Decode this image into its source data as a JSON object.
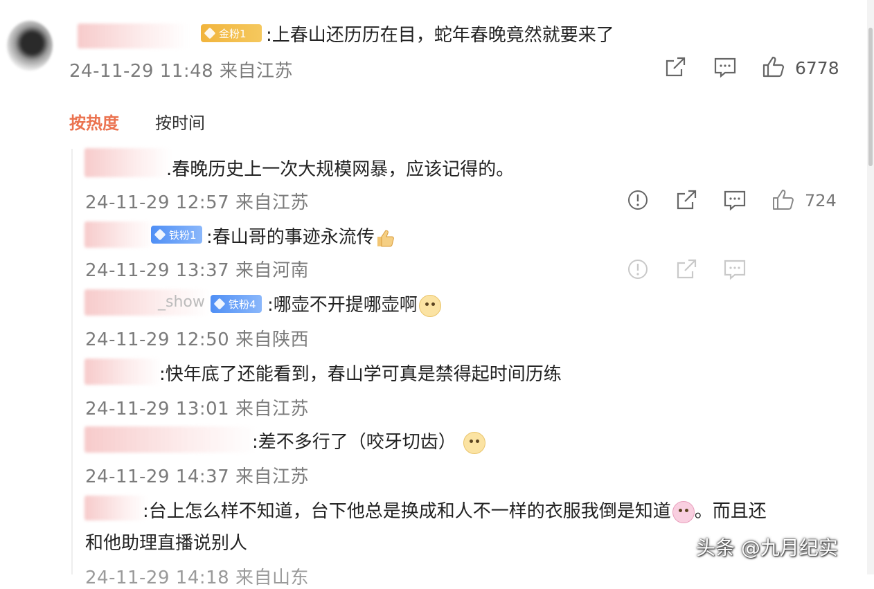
{
  "main_comment": {
    "badge": "金粉1",
    "text": ":上春山还历历在目，蛇年春晚竟然就要来了",
    "meta": "24-11-29 11:48 来自江苏",
    "likes": "6778"
  },
  "sort_tabs": {
    "hot": "按热度",
    "time": "按时间"
  },
  "replies": [
    {
      "text": ".春晚历史上一次大规模网暴，应该记得的。",
      "meta": "24-11-29 12:57 来自江苏",
      "likes": "724"
    },
    {
      "badge": "铁粉1",
      "text": ":春山哥的事迹永流传",
      "meta": "24-11-29 13:37 来自河南"
    },
    {
      "badge": "铁粉4",
      "name_fragment": "_show",
      "text": ":哪壶不开提哪壶啊",
      "meta": "24-11-29 12:50 来自陕西"
    },
    {
      "text": ":快年底了还能看到，春山学可真是禁得起时间历练",
      "meta": "24-11-29 13:01 来自江苏"
    },
    {
      "text": ":差不多行了（咬牙切齿）",
      "meta": "24-11-29 14:37 来自江苏"
    },
    {
      "text": ":台上怎么样不知道，台下他总是换成和人不一样的衣服我倒是知道",
      "text_tail": "。而且还",
      "text_line2": "和他助理直播说别人",
      "meta": "24-11-29 14:18 来自山东"
    }
  ],
  "watermark": "头条 @九月纪实",
  "icons": {
    "share": "share-icon",
    "comment": "comment-icon",
    "like": "thumbs-up-icon",
    "report": "report-icon"
  }
}
